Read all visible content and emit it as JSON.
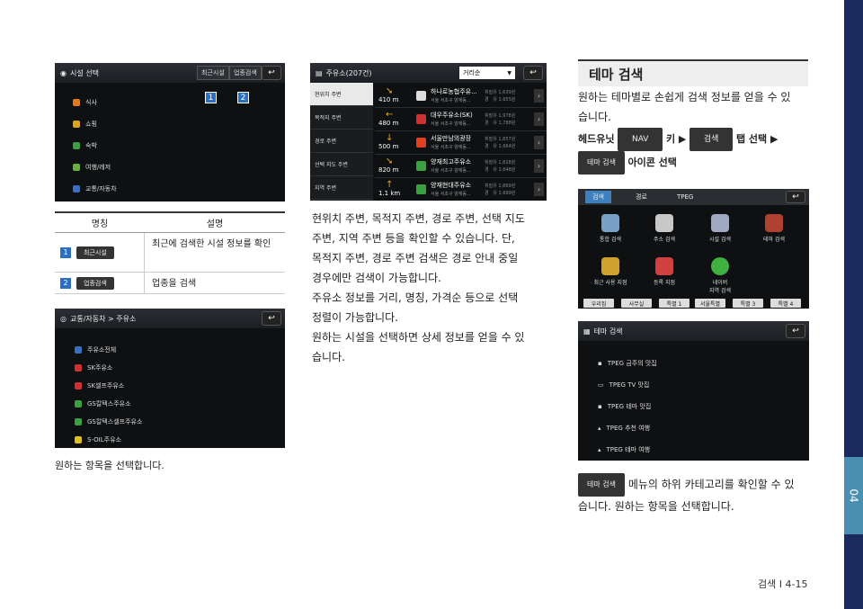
{
  "colors": {
    "sidebar": "#1a2a5c",
    "side_tab": "#4a8fb0",
    "marker": "#2b6fc4"
  },
  "side_tab_label": "04",
  "screen1": {
    "title": "시설 선택",
    "tab_recent": "최근시설",
    "tab_category": "업종검색",
    "items": [
      "식사",
      "쇼핑",
      "숙박",
      "여행/레저",
      "교통/자동차"
    ],
    "marker1": "1",
    "marker2": "2"
  },
  "table": {
    "head_name": "명칭",
    "head_desc": "설명",
    "rows": [
      {
        "num": "1",
        "button": "최근시설",
        "desc": "최근에 검색한 시설 정보를 확인"
      },
      {
        "num": "2",
        "button": "업종검색",
        "desc": "업종을 검색"
      }
    ]
  },
  "screen3": {
    "title": "교통/자동차 > 주유소",
    "items": [
      "주유소전체",
      "SK주유소",
      "SK셀프주유소",
      "GS칼텍스주유소",
      "GS칼텍스셀프주유소",
      "S-OIL주유소"
    ]
  },
  "caption_left": "원하는 항목을 선택합니다.",
  "screen2": {
    "title": "주유소(207건)",
    "sort": "거리순",
    "left_menu": [
      "현위치 주변",
      "목적지 주변",
      "경로 주변",
      "선택 지도 주변",
      "지역 주변"
    ],
    "rows": [
      {
        "dist": "410 m",
        "name": "하나로농협주유...",
        "addr": "서울 서초구 양재동...",
        "price": "휘발유 1,639원\n경   유 1,655원"
      },
      {
        "dist": "480 m",
        "name": "대우주유소(SK)",
        "addr": "서울 서초구 양재동...",
        "price": "휘발유 1,978원\n경   유 1,788원"
      },
      {
        "dist": "500 m",
        "name": "서울만남의광장",
        "addr": "서울 서초구 양재동...",
        "price": "휘발유 1,857원\n경   유 1,664원"
      },
      {
        "dist": "820 m",
        "name": "양재최고주유소",
        "addr": "서울 서초구 양재동...",
        "price": "휘발유 1,828원\n경   유 1,648원"
      },
      {
        "dist": "1.1 km",
        "name": "양재현대주유소",
        "addr": "서울 서초구 양재동...",
        "price": "휘발유 1,869원\n경   유 1,699원"
      }
    ]
  },
  "middle_text": {
    "p1_l1": "현위치 주변, 목적지 주변, 경로 주변, 선택 지도",
    "p1_l2": "주변, 지역 주변 등을 확인할 수 있습니다. 단,",
    "p1_l3": "목적지 주변, 경로 주변 검색은 경로 안내 중일",
    "p1_l4": "경우에만 검색이 가능합니다.",
    "p2_l1": "주유소 정보를 거리, 명칭, 가격순 등으로 선택",
    "p2_l2": "정렬이 가능합니다.",
    "p3_l1": "원하는 시설을 선택하면 상세 정보를 얻을 수 있",
    "p3_l2": "습니다."
  },
  "right": {
    "section_title": "테마 검색",
    "intro_l1": "원하는 테마별로 손쉽게 검색 정보를 얻을 수 있",
    "intro_l2": "습니다.",
    "step_head": "헤드유닛",
    "nav_btn": "NAV",
    "key_word": "키 ▶",
    "search_btn": "검색",
    "tab_select": "탭 선택 ▶",
    "theme_btn": "테마 검색",
    "icon_select": "아이콘 선택",
    "bottom_btn": "테마 검색",
    "bottom_l1": "메뉴의 하위 카테고리를 확인할 수 있",
    "bottom_l2": "습니다. 원하는 항목을 선택합니다."
  },
  "screen4": {
    "tabs": [
      "검색",
      "경로",
      "TPEG"
    ],
    "icons": [
      "통합 검색",
      "주소 검색",
      "시설 검색",
      "테마 검색",
      "최근 사용 지점",
      "등록 지점",
      "네이버\n지역 검색"
    ],
    "buttons": [
      "우리집",
      "사무실",
      "특별 1",
      "서울특별",
      "특별 3",
      "특별 4"
    ]
  },
  "screen5": {
    "title": "테마 검색",
    "items": [
      "TPEG 금주의 맛집",
      "TPEG TV 맛집",
      "TPEG 테마 맛집",
      "TPEG 추천 여행",
      "TPEG 테마 여행"
    ]
  },
  "footer": "검색 I 4-15"
}
